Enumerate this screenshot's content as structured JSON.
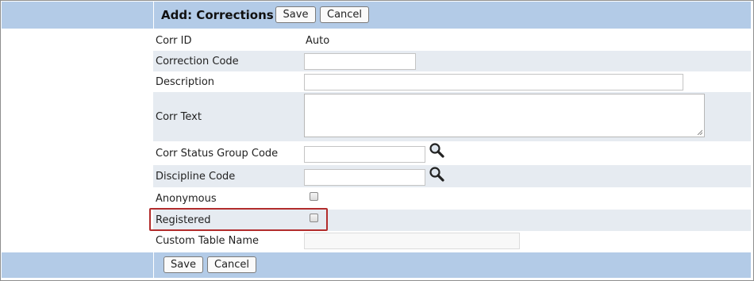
{
  "header": {
    "title": "Add: Corrections",
    "save_label": "Save",
    "cancel_label": "Cancel"
  },
  "footer": {
    "save_label": "Save",
    "cancel_label": "Cancel"
  },
  "fields": {
    "corr_id": {
      "label": "Corr ID",
      "value": "Auto"
    },
    "correction_code": {
      "label": "Correction Code",
      "value": ""
    },
    "description": {
      "label": "Description",
      "value": ""
    },
    "corr_text": {
      "label": "Corr Text",
      "value": ""
    },
    "corr_status_group_code": {
      "label": "Corr Status Group Code",
      "value": ""
    },
    "discipline_code": {
      "label": "Discipline Code",
      "value": ""
    },
    "anonymous": {
      "label": "Anonymous",
      "checked": false
    },
    "registered": {
      "label": "Registered",
      "checked": false
    },
    "custom_table_name": {
      "label": "Custom Table Name",
      "value": ""
    }
  },
  "icons": {
    "lookup": "magnifier-icon",
    "resize": "resize-grip-icon"
  },
  "colors": {
    "band": "#b3cbe7",
    "alt_row": "#e6ebf1",
    "highlight": "#b22c2c"
  }
}
